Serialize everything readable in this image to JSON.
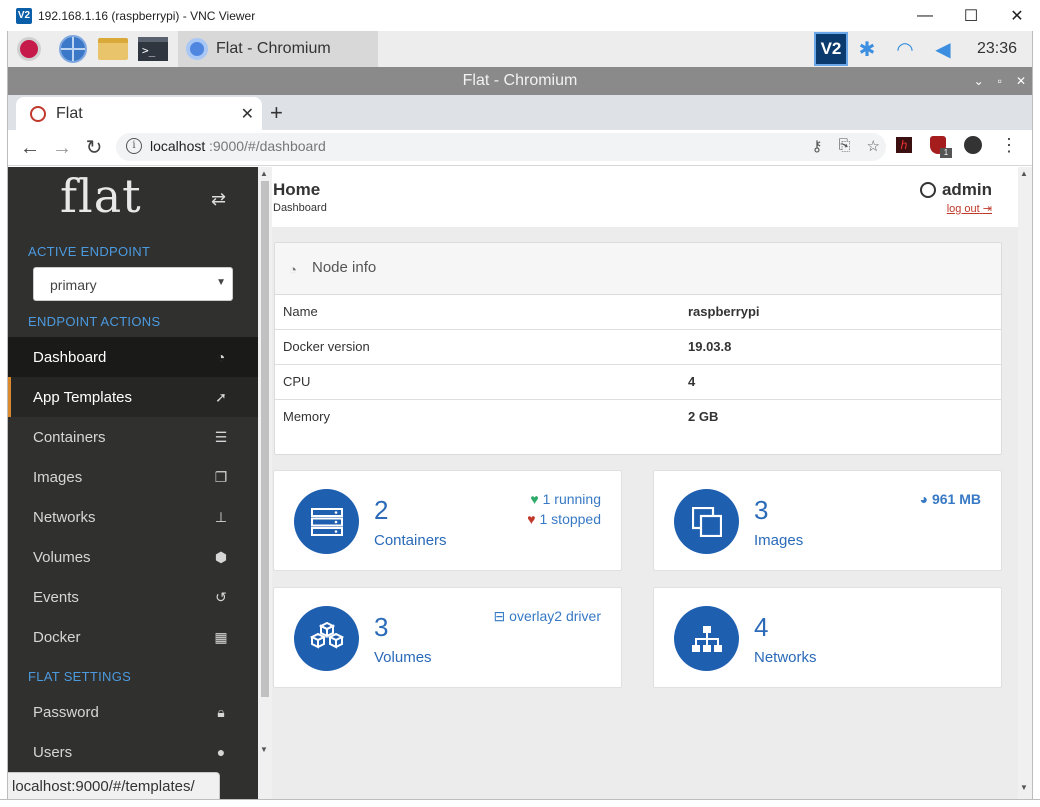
{
  "vnc": {
    "logo": "V2",
    "title": "192.168.1.16 (raspberrypi) - VNC Viewer",
    "minimize": "—",
    "maximize": "☐",
    "close": "✕"
  },
  "taskbar": {
    "terminal_glyph": ">_",
    "task_label": "Flat - Chromium",
    "vnc_glyph": "V2",
    "clock": "23:36"
  },
  "chromium": {
    "window_title": "Flat - Chromium",
    "tab_label": "Flat",
    "url_host": "localhost",
    "url_path": ":9000/#/dashboard",
    "ext_h": "h",
    "ext_badge": "1"
  },
  "sidebar": {
    "logo": "flat",
    "active_endpoint_heading": "ACTIVE ENDPOINT",
    "endpoint_selected": "primary",
    "endpoint_actions_heading": "ENDPOINT ACTIONS",
    "flat_settings_heading": "FLAT SETTINGS",
    "items": [
      {
        "label": "Dashboard",
        "icon": "tachometer-icon"
      },
      {
        "label": "App Templates",
        "icon": "rocket-icon"
      },
      {
        "label": "Containers",
        "icon": "server-icon"
      },
      {
        "label": "Images",
        "icon": "clone-icon"
      },
      {
        "label": "Networks",
        "icon": "sitemap-icon"
      },
      {
        "label": "Volumes",
        "icon": "cubes-icon"
      },
      {
        "label": "Events",
        "icon": "history-icon"
      },
      {
        "label": "Docker",
        "icon": "th-icon"
      }
    ],
    "settings_items": [
      {
        "label": "Password",
        "icon": "lock-icon"
      },
      {
        "label": "Users",
        "icon": "user-icon"
      }
    ]
  },
  "header": {
    "title": "Home",
    "breadcrumb": "Dashboard",
    "user": "admin",
    "logout": "log out"
  },
  "node_info": {
    "title": "Node info",
    "rows": [
      {
        "key": "Name",
        "value": "raspberrypi"
      },
      {
        "key": "Docker version",
        "value": "19.03.8"
      },
      {
        "key": "CPU",
        "value": "4"
      },
      {
        "key": "Memory",
        "value": "2 GB"
      }
    ]
  },
  "cards": {
    "containers": {
      "count": "2",
      "label": "Containers",
      "running": "1 running",
      "stopped": "1 stopped"
    },
    "images": {
      "count": "3",
      "label": "Images",
      "size": "961 MB"
    },
    "volumes": {
      "count": "3",
      "label": "Volumes",
      "driver": "overlay2 driver"
    },
    "networks": {
      "count": "4",
      "label": "Networks"
    }
  },
  "status_bar": {
    "url": "localhost:9000/#/templates/"
  },
  "colors": {
    "sidebar_bg": "#30302e",
    "accent_blue": "#1f5faf",
    "link_blue": "#2a6ab8",
    "active_orange": "#d9892e"
  }
}
